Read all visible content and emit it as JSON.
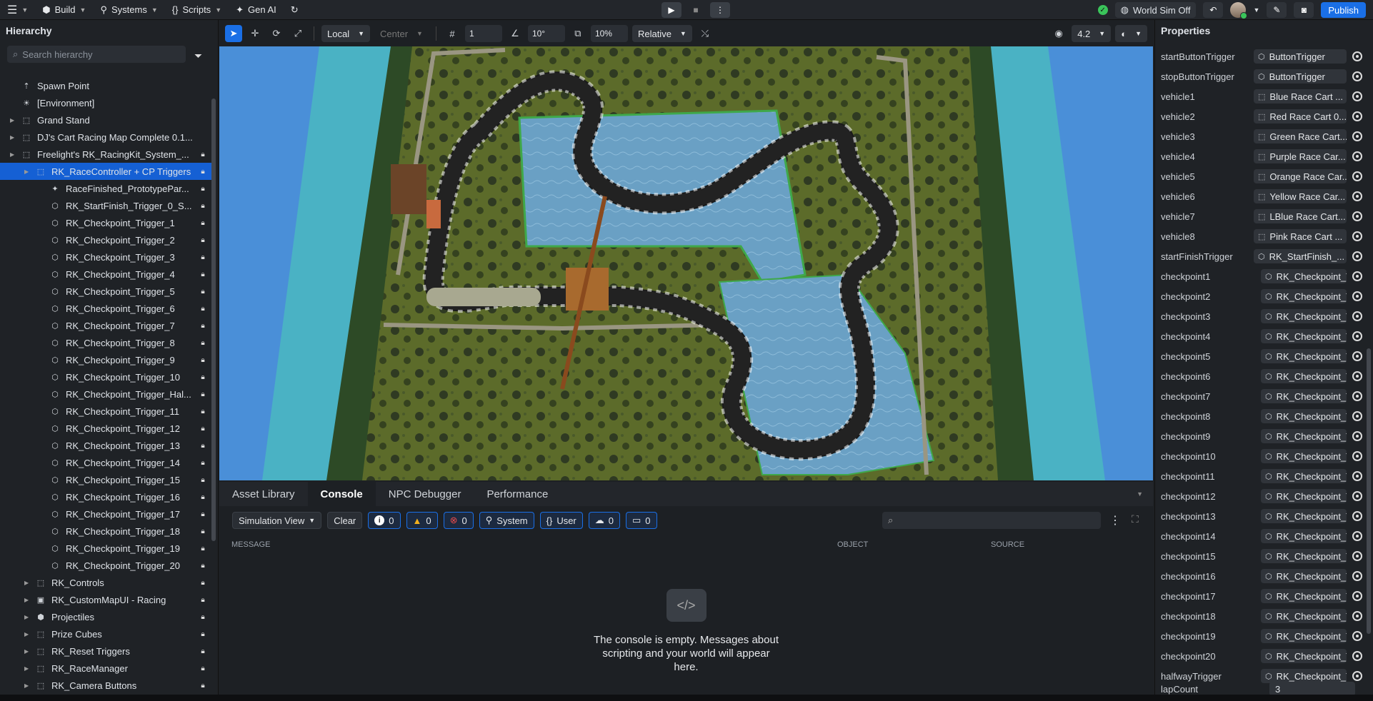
{
  "topbar": {
    "build": "Build",
    "systems": "Systems",
    "scripts": "Scripts",
    "genai": "Gen AI",
    "world_sim": "World Sim Off",
    "publish": "Publish"
  },
  "hierarchy": {
    "title": "Hierarchy",
    "search_placeholder": "Search hierarchy",
    "items": [
      {
        "label": "Spawn Point",
        "icon": "spawn-icon",
        "depth": 0,
        "arrow": false,
        "lock": false,
        "selected": false
      },
      {
        "label": "[Environment]",
        "icon": "environment-icon",
        "depth": 0,
        "arrow": false,
        "lock": false,
        "selected": false
      },
      {
        "label": "Grand Stand",
        "icon": "group-icon",
        "depth": 0,
        "arrow": true,
        "lock": false,
        "selected": false
      },
      {
        "label": "DJ's Cart Racing Map Complete 0.1...",
        "icon": "group-icon",
        "depth": 0,
        "arrow": true,
        "lock": false,
        "selected": false
      },
      {
        "label": "Freelight's RK_RacingKit_System_...",
        "icon": "group-icon",
        "depth": 0,
        "arrow": true,
        "lock": true,
        "selected": false
      },
      {
        "label": "RK_RaceController + CP Triggers",
        "icon": "group-icon",
        "depth": 1,
        "arrow": true,
        "lock": true,
        "selected": true
      },
      {
        "label": "RaceFinished_PrototypePar...",
        "icon": "particle-icon",
        "depth": 2,
        "arrow": false,
        "lock": true,
        "selected": false
      },
      {
        "label": "RK_StartFinish_Trigger_0_S...",
        "icon": "trigger-icon",
        "depth": 2,
        "arrow": false,
        "lock": true,
        "selected": false
      },
      {
        "label": "RK_Checkpoint_Trigger_1",
        "icon": "trigger-icon",
        "depth": 2,
        "arrow": false,
        "lock": true,
        "selected": false
      },
      {
        "label": "RK_Checkpoint_Trigger_2",
        "icon": "trigger-icon",
        "depth": 2,
        "arrow": false,
        "lock": true,
        "selected": false
      },
      {
        "label": "RK_Checkpoint_Trigger_3",
        "icon": "trigger-icon",
        "depth": 2,
        "arrow": false,
        "lock": true,
        "selected": false
      },
      {
        "label": "RK_Checkpoint_Trigger_4",
        "icon": "trigger-icon",
        "depth": 2,
        "arrow": false,
        "lock": true,
        "selected": false
      },
      {
        "label": "RK_Checkpoint_Trigger_5",
        "icon": "trigger-icon",
        "depth": 2,
        "arrow": false,
        "lock": true,
        "selected": false
      },
      {
        "label": "RK_Checkpoint_Trigger_6",
        "icon": "trigger-icon",
        "depth": 2,
        "arrow": false,
        "lock": true,
        "selected": false
      },
      {
        "label": "RK_Checkpoint_Trigger_7",
        "icon": "trigger-icon",
        "depth": 2,
        "arrow": false,
        "lock": true,
        "selected": false
      },
      {
        "label": "RK_Checkpoint_Trigger_8",
        "icon": "trigger-icon",
        "depth": 2,
        "arrow": false,
        "lock": true,
        "selected": false
      },
      {
        "label": "RK_Checkpoint_Trigger_9",
        "icon": "trigger-icon",
        "depth": 2,
        "arrow": false,
        "lock": true,
        "selected": false
      },
      {
        "label": "RK_Checkpoint_Trigger_10",
        "icon": "trigger-icon",
        "depth": 2,
        "arrow": false,
        "lock": true,
        "selected": false
      },
      {
        "label": "RK_Checkpoint_Trigger_Hal...",
        "icon": "trigger-icon",
        "depth": 2,
        "arrow": false,
        "lock": true,
        "selected": false
      },
      {
        "label": "RK_Checkpoint_Trigger_11",
        "icon": "trigger-icon",
        "depth": 2,
        "arrow": false,
        "lock": true,
        "selected": false
      },
      {
        "label": "RK_Checkpoint_Trigger_12",
        "icon": "trigger-icon",
        "depth": 2,
        "arrow": false,
        "lock": true,
        "selected": false
      },
      {
        "label": "RK_Checkpoint_Trigger_13",
        "icon": "trigger-icon",
        "depth": 2,
        "arrow": false,
        "lock": true,
        "selected": false
      },
      {
        "label": "RK_Checkpoint_Trigger_14",
        "icon": "trigger-icon",
        "depth": 2,
        "arrow": false,
        "lock": true,
        "selected": false
      },
      {
        "label": "RK_Checkpoint_Trigger_15",
        "icon": "trigger-icon",
        "depth": 2,
        "arrow": false,
        "lock": true,
        "selected": false
      },
      {
        "label": "RK_Checkpoint_Trigger_16",
        "icon": "trigger-icon",
        "depth": 2,
        "arrow": false,
        "lock": true,
        "selected": false
      },
      {
        "label": "RK_Checkpoint_Trigger_17",
        "icon": "trigger-icon",
        "depth": 2,
        "arrow": false,
        "lock": true,
        "selected": false
      },
      {
        "label": "RK_Checkpoint_Trigger_18",
        "icon": "trigger-icon",
        "depth": 2,
        "arrow": false,
        "lock": true,
        "selected": false
      },
      {
        "label": "RK_Checkpoint_Trigger_19",
        "icon": "trigger-icon",
        "depth": 2,
        "arrow": false,
        "lock": true,
        "selected": false
      },
      {
        "label": "RK_Checkpoint_Trigger_20",
        "icon": "trigger-icon",
        "depth": 2,
        "arrow": false,
        "lock": true,
        "selected": false
      },
      {
        "label": "RK_Controls",
        "icon": "group-icon",
        "depth": 1,
        "arrow": true,
        "lock": true,
        "selected": false
      },
      {
        "label": "RK_CustomMapUI - Racing",
        "icon": "ui-icon",
        "depth": 1,
        "arrow": true,
        "lock": true,
        "selected": false
      },
      {
        "label": "Projectiles",
        "icon": "object-icon",
        "depth": 1,
        "arrow": true,
        "lock": true,
        "selected": false
      },
      {
        "label": "Prize Cubes",
        "icon": "group-icon",
        "depth": 1,
        "arrow": true,
        "lock": true,
        "selected": false
      },
      {
        "label": "RK_Reset Triggers",
        "icon": "group-icon",
        "depth": 1,
        "arrow": true,
        "lock": true,
        "selected": false
      },
      {
        "label": "RK_RaceManager",
        "icon": "group-icon",
        "depth": 1,
        "arrow": true,
        "lock": true,
        "selected": false
      },
      {
        "label": "RK_Camera Buttons",
        "icon": "group-icon",
        "depth": 1,
        "arrow": true,
        "lock": true,
        "selected": false
      }
    ]
  },
  "viewport_toolbar": {
    "space": "Local",
    "pivot": "Center",
    "grid_snap": "1",
    "rotate_snap": "10°",
    "scale_snap": "10%",
    "relative": "Relative",
    "camera_speed": "4.2"
  },
  "bottom_panel": {
    "tabs": [
      "Asset Library",
      "Console",
      "NPC Debugger",
      "Performance"
    ],
    "active_tab": 1,
    "view_select": "Simulation View",
    "clear": "Clear",
    "info_count": "0",
    "warn_count": "0",
    "error_count": "0",
    "system": "System",
    "user": "User",
    "cloud_count": "0",
    "device_count": "0",
    "col_message": "MESSAGE",
    "col_object": "OBJECT",
    "col_source": "SOURCE",
    "empty_message": "The console is empty. Messages about scripting and your world will appear here."
  },
  "properties": {
    "title": "Properties",
    "rows": [
      {
        "name": "startButtonTrigger",
        "value": "ButtonTrigger",
        "icon": "trigger-icon"
      },
      {
        "name": "stopButtonTrigger",
        "value": "ButtonTrigger",
        "icon": "trigger-icon"
      },
      {
        "name": "vehicle1",
        "value": "Blue Race Cart ...",
        "icon": "group-icon"
      },
      {
        "name": "vehicle2",
        "value": "Red Race Cart 0...",
        "icon": "group-icon"
      },
      {
        "name": "vehicle3",
        "value": "Green Race Cart...",
        "icon": "group-icon"
      },
      {
        "name": "vehicle4",
        "value": "Purple Race Car...",
        "icon": "group-icon"
      },
      {
        "name": "vehicle5",
        "value": "Orange Race Car...",
        "icon": "group-icon"
      },
      {
        "name": "vehicle6",
        "value": "Yellow Race Car...",
        "icon": "group-icon"
      },
      {
        "name": "vehicle7",
        "value": "LBlue Race Cart...",
        "icon": "group-icon"
      },
      {
        "name": "vehicle8",
        "value": "Pink Race Cart ...",
        "icon": "group-icon"
      },
      {
        "name": "startFinishTrigger",
        "value": "RK_StartFinish_...",
        "icon": "trigger-icon"
      },
      {
        "name": "checkpoint1",
        "value": "RK_Checkpoint_T...",
        "icon": "trigger-icon"
      },
      {
        "name": "checkpoint2",
        "value": "RK_Checkpoint_T...",
        "icon": "trigger-icon"
      },
      {
        "name": "checkpoint3",
        "value": "RK_Checkpoint_T...",
        "icon": "trigger-icon"
      },
      {
        "name": "checkpoint4",
        "value": "RK_Checkpoint_T...",
        "icon": "trigger-icon"
      },
      {
        "name": "checkpoint5",
        "value": "RK_Checkpoint_T...",
        "icon": "trigger-icon"
      },
      {
        "name": "checkpoint6",
        "value": "RK_Checkpoint_T...",
        "icon": "trigger-icon"
      },
      {
        "name": "checkpoint7",
        "value": "RK_Checkpoint_T...",
        "icon": "trigger-icon"
      },
      {
        "name": "checkpoint8",
        "value": "RK_Checkpoint_T...",
        "icon": "trigger-icon"
      },
      {
        "name": "checkpoint9",
        "value": "RK_Checkpoint_T...",
        "icon": "trigger-icon"
      },
      {
        "name": "checkpoint10",
        "value": "RK_Checkpoint_T...",
        "icon": "trigger-icon"
      },
      {
        "name": "checkpoint11",
        "value": "RK_Checkpoint_T...",
        "icon": "trigger-icon"
      },
      {
        "name": "checkpoint12",
        "value": "RK_Checkpoint_T...",
        "icon": "trigger-icon"
      },
      {
        "name": "checkpoint13",
        "value": "RK_Checkpoint_T...",
        "icon": "trigger-icon"
      },
      {
        "name": "checkpoint14",
        "value": "RK_Checkpoint_T...",
        "icon": "trigger-icon"
      },
      {
        "name": "checkpoint15",
        "value": "RK_Checkpoint_T...",
        "icon": "trigger-icon"
      },
      {
        "name": "checkpoint16",
        "value": "RK_Checkpoint_T...",
        "icon": "trigger-icon"
      },
      {
        "name": "checkpoint17",
        "value": "RK_Checkpoint_T...",
        "icon": "trigger-icon"
      },
      {
        "name": "checkpoint18",
        "value": "RK_Checkpoint_T...",
        "icon": "trigger-icon"
      },
      {
        "name": "checkpoint19",
        "value": "RK_Checkpoint_T...",
        "icon": "trigger-icon"
      },
      {
        "name": "checkpoint20",
        "value": "RK_Checkpoint_T...",
        "icon": "trigger-icon"
      },
      {
        "name": "halfwayTrigger",
        "value": "RK_Checkpoint_T...",
        "icon": "trigger-icon"
      }
    ],
    "lap_count_label": "lapCount",
    "lap_count_value": "3"
  },
  "colors": {
    "accent": "#1a6fe6",
    "selected_row": "#1560d4",
    "status_green": "#3ac45a"
  }
}
